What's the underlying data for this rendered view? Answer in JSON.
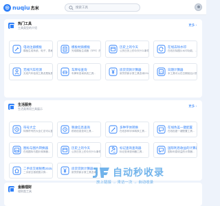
{
  "header": {
    "logo_text": "nuqiu",
    "logo_suffix": "杰米",
    "search_placeholder": "搜索工具"
  },
  "sections": [
    {
      "title": "热门工具",
      "subtitle": "工具类型的介绍",
      "more": "更多 ›",
      "cards": [
        {
          "title": "电动注册模板",
          "desc": "模板生成系统、电子、表格...",
          "icon": "tools-icon"
        },
        {
          "title": "模板材质模板",
          "desc": "完成模板生成器（SPE）的...",
          "icon": "document-icon"
        },
        {
          "title": "历史上的今天",
          "desc": "公历日历上的今天什么事件...",
          "icon": "calendar-icon"
        },
        {
          "title": "在线去除水印",
          "desc": "在线去除图片水印功能，...",
          "icon": "refresh-icon"
        },
        {
          "title": "无线汽车检测",
          "desc": "无线汽车检测工具说是免费...",
          "icon": "person-icon"
        },
        {
          "title": "车牌号查询",
          "desc": "车牌号查询系统工具...",
          "icon": "car-icon"
        },
        {
          "title": "房贷贷款计算器",
          "desc": "房贷贷款计算工具查询DSA...",
          "icon": "yen-icon"
        },
        {
          "title": "日期计算器",
          "desc": "本工具可以在日期前后计算...",
          "icon": "date-icon"
        }
      ]
    },
    {
      "title": "生活服务",
      "subtitle": "生活类常用工具展示",
      "more": "更多 ›",
      "cards": [
        {
          "title": "符号大全",
          "desc": "特殊符号的大全汇总可以复...",
          "icon": "clock-icon"
        },
        {
          "title": "税收信息查询",
          "desc": "税收信息查询工具...",
          "icon": "clock-icon"
        },
        {
          "title": "多种字体转换",
          "desc": "在线多种字体转换工具...",
          "icon": "magic-icon"
        },
        {
          "title": "在线色差一键配置",
          "desc": "在线色差一键配置工具...",
          "icon": "chat-icon"
        },
        {
          "title": "图标与图片转换器",
          "desc": "在线图标与图片转换器...",
          "icon": "image-icon"
        },
        {
          "title": "历史上的今天",
          "desc": "公历日历上的今天什么事件...",
          "icon": "calendar-icon"
        },
        {
          "title": "标记查询查询器",
          "desc": "标记查询查询器工具...",
          "icon": "gavel-icon"
        },
        {
          "title": "国际利息收益的计算器",
          "desc": "国际利息收益的计算器...",
          "icon": "chat-icon"
        },
        {
          "title": "二手房交易税费2025最新",
          "desc": "二手房交易税费计算...",
          "icon": "house-icon"
        },
        {
          "title": "房贷贷款计算器",
          "desc": "房贷贷款计算工具查询...",
          "icon": "yen-icon"
        }
      ]
    },
    {
      "title": "金融理财",
      "subtitle": "理财类工具",
      "more": ""
    }
  ],
  "watermark": {
    "title": "自动秒收录",
    "line": "放上链接 → 来访一次 → 自动收录"
  },
  "colors": {
    "accent": "#2d7ff9",
    "page_bg": "#eef3fb"
  }
}
